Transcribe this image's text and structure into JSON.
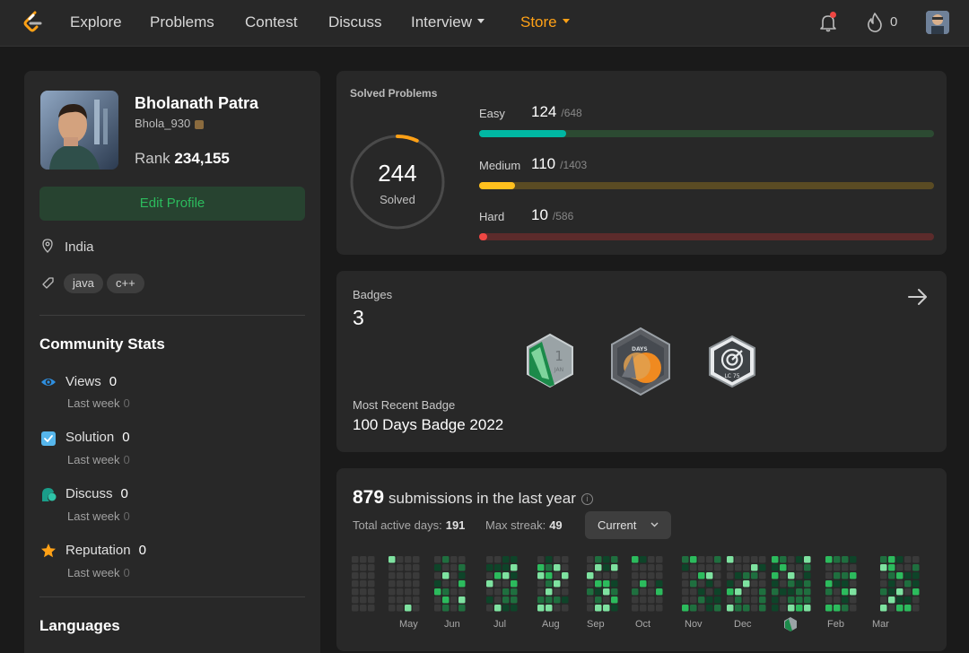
{
  "nav": {
    "items": [
      "Explore",
      "Problems",
      "Contest",
      "Discuss",
      "Interview",
      "Store"
    ],
    "streak_count": "0",
    "colors": {
      "accent": "#ffa116",
      "bg": "#282828",
      "notification_dot": "#ef4743"
    }
  },
  "profile": {
    "name": "Bholanath Patra",
    "username": "Bhola_930",
    "rank_label": "Rank",
    "rank_value": "234,155",
    "edit_label": "Edit Profile",
    "location": "India",
    "skills": [
      "java",
      "c++"
    ]
  },
  "community": {
    "title": "Community Stats",
    "stats": [
      {
        "label": "Views",
        "value": "0",
        "sub_label": "Last week",
        "sub_value": "0",
        "icon": "eye-icon"
      },
      {
        "label": "Solution",
        "value": "0",
        "sub_label": "Last week",
        "sub_value": "0",
        "icon": "solution-check-icon"
      },
      {
        "label": "Discuss",
        "value": "0",
        "sub_label": "Last week",
        "sub_value": "0",
        "icon": "discuss-bubble-icon"
      },
      {
        "label": "Reputation",
        "value": "0",
        "sub_label": "Last week",
        "sub_value": "0",
        "icon": "star-icon"
      }
    ]
  },
  "languages": {
    "title": "Languages"
  },
  "solved": {
    "title": "Solved Problems",
    "total": "244",
    "total_label": "Solved",
    "progress_fraction": 0.07,
    "difficulties": [
      {
        "label": "Easy",
        "solved": "124",
        "total": "/648",
        "fraction": 0.191,
        "color": "#00b8a3",
        "track": "#2c4a32"
      },
      {
        "label": "Medium",
        "solved": "110",
        "total": "/1403",
        "fraction": 0.078,
        "color": "#ffc01e",
        "track": "#5a4b23"
      },
      {
        "label": "Hard",
        "solved": "10",
        "total": "/586",
        "fraction": 0.017,
        "color": "#ef4743",
        "track": "#5c2b2b"
      }
    ]
  },
  "badges": {
    "label": "Badges",
    "count": "3",
    "items": [
      {
        "name": "jan-2023-badge",
        "text": "1",
        "sub": "JAN"
      },
      {
        "name": "100-days-badge",
        "text": "DAYS"
      },
      {
        "name": "lc75-badge",
        "text": "LC 75"
      }
    ],
    "recent_label": "Most Recent Badge",
    "recent_name": "100 Days Badge 2022"
  },
  "submissions": {
    "count": "879",
    "text": "submissions in the last year",
    "active_days_label": "Total active days:",
    "active_days": "191",
    "max_streak_label": "Max streak:",
    "max_streak": "49",
    "range_select": "Current",
    "months": [
      "May",
      "Jun",
      "Jul",
      "Aug",
      "Sep",
      "Oct",
      "Nov",
      "Dec",
      "Feb",
      "Mar"
    ]
  }
}
